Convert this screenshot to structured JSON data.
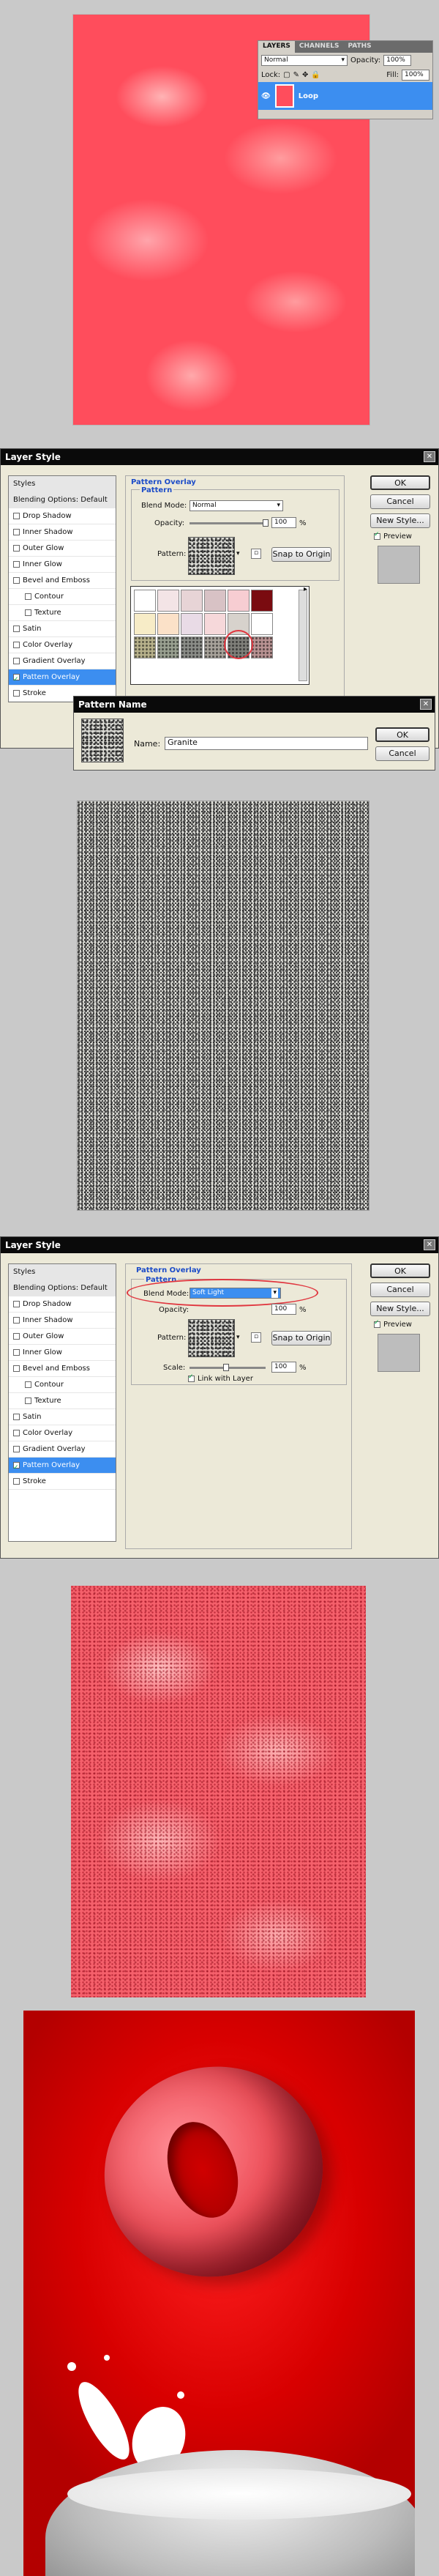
{
  "layers_panel": {
    "tabs": [
      "LAYERS",
      "CHANNELS",
      "PATHS"
    ],
    "blend_mode": "Normal",
    "opacity_label": "Opacity:",
    "opacity": "100%",
    "lock_label": "Lock:",
    "fill_label": "Fill:",
    "fill": "100%",
    "layer_name": "Loop"
  },
  "layer_style_1": {
    "title": "Layer Style",
    "styles": [
      {
        "label": "Styles",
        "type": "hdr"
      },
      {
        "label": "Blending Options: Default",
        "type": "hdr"
      },
      {
        "label": "Drop Shadow"
      },
      {
        "label": "Inner Shadow"
      },
      {
        "label": "Outer Glow"
      },
      {
        "label": "Inner Glow"
      },
      {
        "label": "Bevel and Emboss"
      },
      {
        "label": "Contour",
        "indent": true
      },
      {
        "label": "Texture",
        "indent": true
      },
      {
        "label": "Satin"
      },
      {
        "label": "Color Overlay"
      },
      {
        "label": "Gradient Overlay"
      },
      {
        "label": "Pattern Overlay",
        "active": true
      },
      {
        "label": "Stroke"
      }
    ],
    "section_title": "Pattern Overlay",
    "group_title": "Pattern",
    "blend_mode_label": "Blend Mode:",
    "blend_mode": "Normal",
    "opacity_label": "Opacity:",
    "opacity_value": "100",
    "percent": "%",
    "pattern_label": "Pattern:",
    "snap_button": "Snap to Origin",
    "ok": "OK",
    "cancel": "Cancel",
    "new_style": "New Style...",
    "preview": "Preview"
  },
  "pattern_name_dialog": {
    "title": "Pattern Name",
    "name_label": "Name:",
    "name_value": "Granite",
    "ok": "OK",
    "cancel": "Cancel"
  },
  "picker_colors": [
    "#ffffff",
    "#f3e4e6",
    "#e7d4d6",
    "#d8c2c5",
    "#f7cdd2",
    "#7a0b10",
    "#f7ecc7",
    "#fbe1c8",
    "#e9dbe6",
    "#f6d8da",
    "#d7d2cc",
    "#ffffff",
    "#b8b28c",
    "#9aa191",
    "#8b8d88",
    "#a8a39b",
    "#7f7f7a",
    "#b99393"
  ],
  "layer_style_2": {
    "title": "Layer Style",
    "section_title": "Pattern Overlay",
    "group_title": "Pattern",
    "blend_mode_label": "Blend Mode:",
    "blend_mode": "Soft Light",
    "opacity_label": "Opacity:",
    "opacity_value": "100",
    "percent": "%",
    "pattern_label": "Pattern:",
    "snap_button": "Snap to Origin",
    "scale_label": "Scale:",
    "scale_value": "100",
    "link_label": "Link with Layer",
    "ok": "OK",
    "cancel": "Cancel",
    "new_style": "New Style...",
    "preview": "Preview"
  }
}
